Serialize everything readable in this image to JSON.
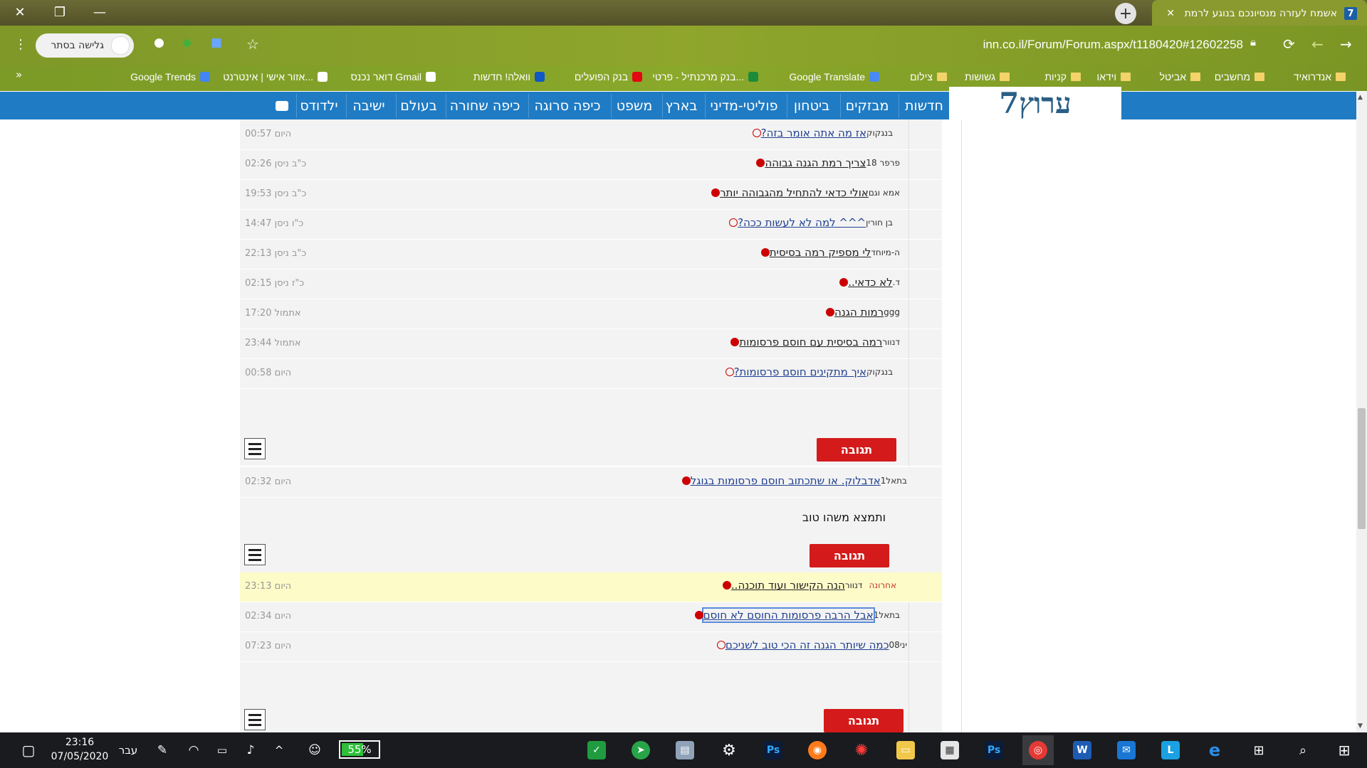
{
  "tab": {
    "title": "אשמח לעזרה מנסיונכם בנוגע לרמת ההגנה",
    "favicon": "7"
  },
  "toolbar": {
    "url": "inn.co.il/Forum/Forum.aspx/t1180420#12602258",
    "incognito_label": "גלישה בסתר"
  },
  "bookmarks": [
    {
      "label": "אנדרואיד",
      "icon": "folder"
    },
    {
      "label": "מחשבים",
      "icon": "folder"
    },
    {
      "label": "אביטל",
      "icon": "folder"
    },
    {
      "label": "וידאו",
      "icon": "folder"
    },
    {
      "label": "קניות",
      "icon": "folder"
    },
    {
      "label": "גשושות",
      "icon": "folder"
    },
    {
      "label": "צילום",
      "icon": "folder"
    },
    {
      "label": "Google Translate",
      "icon": "translate"
    },
    {
      "label": "בנק מרכנתיל - פרטי...",
      "icon": "bank-mercantile"
    },
    {
      "label": "בנק הפועלים",
      "icon": "bank-hapoalim"
    },
    {
      "label": "וואלה! חדשות",
      "icon": "walla"
    },
    {
      "label": "דואר נכנס Gmail",
      "icon": "gmail"
    },
    {
      "label": "אזור אישי | אינטרנט...",
      "icon": "personal-area"
    },
    {
      "label": "Google Trends",
      "icon": "trends"
    }
  ],
  "logo": {
    "text": "ערוץ7"
  },
  "nav": [
    "חדשות",
    "מבזקים",
    "ביטחון",
    "פוליטי-מדיני",
    "בארץ",
    "משפט",
    "כיפה סרוגה",
    "כיפה שחורה",
    "בעולם",
    "ישיבה",
    "ילדודס"
  ],
  "rows": [
    {
      "title": "אז מה אתה אומר בזה?",
      "author": "בנגקוק",
      "time": "היום 00:57",
      "read": false
    },
    {
      "title": "צריך רמת הגנה גבוהה",
      "author": "פרפר 18",
      "time": "כ\"ב ניסן 02:26",
      "read": true
    },
    {
      "title": "אולי כדאי להתחיל מהגבוהה יותר",
      "author": "אמא וגם",
      "time": "כ\"ב ניסן 19:53",
      "read": true
    },
    {
      "title": "^^^ למה לא לעשות ככה?",
      "author": "בן חורין",
      "time": "כ\"ו ניסן 14:47",
      "read": false
    },
    {
      "title": "לי מספיק רמה בסיסית",
      "author": "ה-מיוחד",
      "time": "כ\"ב ניסן 22:13",
      "read": true
    },
    {
      "title": "לא כדאי..",
      "author": "ד.",
      "time": "כ\"ז ניסן 02:15",
      "read": true
    },
    {
      "title": "רמות הגנה",
      "author": "ggg",
      "time": "אתמול 17:20",
      "read": true
    },
    {
      "title": "רמה בסיסית עם חוסם פרסומות",
      "author": "דנוור",
      "time": "אתמול 23:44",
      "read": true
    },
    {
      "title": "איך מתקינים חוסם פרסומות?",
      "author": "בנגקוק",
      "time": "היום 00:58",
      "read": false
    }
  ],
  "reply_label": "תגובה",
  "post2": {
    "title": "אדבלוק. או שתכתוב חוסם פרסומות בגוגל",
    "author": "בתאל1",
    "time": "היום 02:32",
    "body": "ותמצא משהו טוב"
  },
  "rows3": [
    {
      "title": "הנה הקישור ועוד תוכנה..",
      "author": "דנוור",
      "last": "אחרונה",
      "time": "היום 23:13",
      "read": true,
      "highlight": true
    },
    {
      "title": "אבל הרבה פרסומות החוסם לא חוסם",
      "author": "בתאל1",
      "time": "היום 02:34",
      "read": true,
      "selected": true
    },
    {
      "title": "כמה שיותר הגנה זה הכי טוב לשניכם",
      "author": "יני08",
      "time": "היום 07:23",
      "read": false
    }
  ],
  "taskbar": {
    "time": "23:16",
    "date": "07/05/2020",
    "lang": "עבר",
    "battery": "55%"
  }
}
